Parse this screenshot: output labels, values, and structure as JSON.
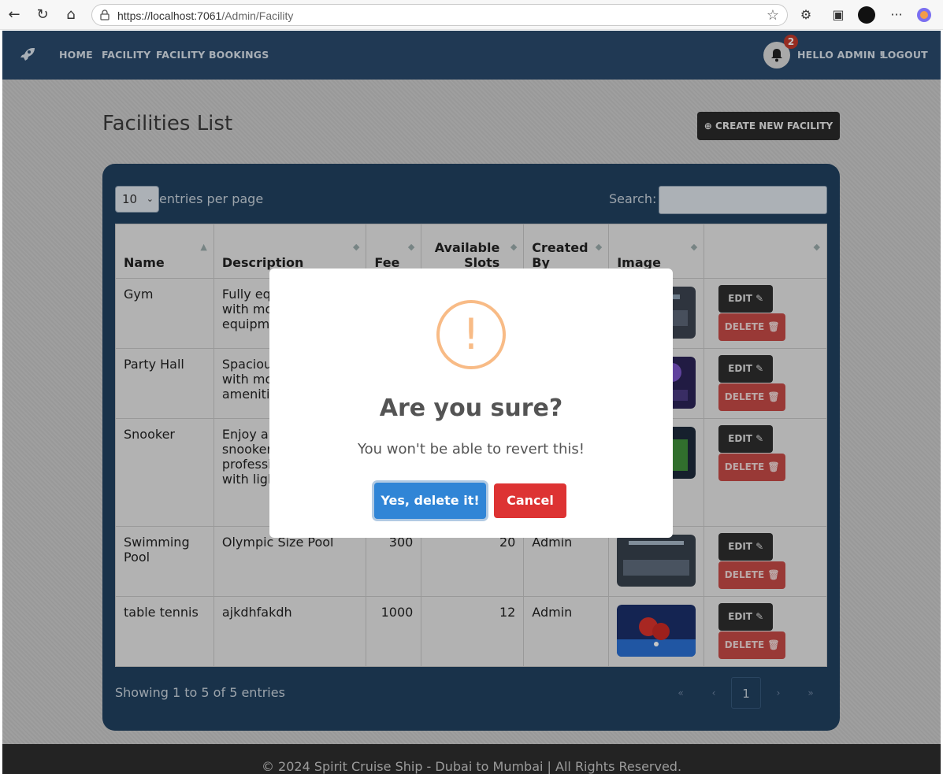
{
  "browser": {
    "url_host": "https://localhost:7061",
    "url_path": "/Admin/Facility"
  },
  "navbar": {
    "links": [
      "HOME",
      "FACILITY",
      "FACILITY BOOKINGS"
    ],
    "notifications_count": "2",
    "greeting": "HELLO ADMIN !",
    "logout": "LOGOUT",
    "bg_color": "#2a4a6c"
  },
  "page": {
    "title": "Facilities List",
    "create_button": "CREATE NEW FACILITY"
  },
  "table_controls": {
    "per_page_value": "10",
    "per_page_label": "entries per page",
    "search_label": "Search:"
  },
  "table": {
    "headers": [
      "Name",
      "Description",
      "Fee",
      "Available Slots",
      "Created By",
      "Image",
      ""
    ],
    "rows": [
      {
        "name": "Gym",
        "description": "Fully equipped gym with modern equipment",
        "fee": "",
        "slots": "",
        "created_by": "",
        "image": "gym"
      },
      {
        "name": "Party Hall",
        "description": "Spacious party hall with modern amenities",
        "fee": "",
        "slots": "",
        "created_by": "",
        "image": "party-hall"
      },
      {
        "name": "Snooker",
        "description": "Enjoy a game of snooker on professional tables with lighting",
        "fee": "",
        "slots": "",
        "created_by": "",
        "image": "snooker"
      },
      {
        "name": "Swimming Pool",
        "description": "Olympic Size Pool",
        "fee": "300",
        "slots": "20",
        "created_by": "Admin",
        "image": "pool"
      },
      {
        "name": "table tennis",
        "description": "ajkdhfakdh",
        "fee": "1000",
        "slots": "12",
        "created_by": "Admin",
        "image": "table-tennis"
      }
    ],
    "edit_label": "EDIT",
    "delete_label": "DELETE"
  },
  "pagination": {
    "summary": "Showing 1 to 5 of 5 entries",
    "first": "«",
    "prev": "‹",
    "current": "1",
    "next": "›",
    "last": "»"
  },
  "footer": {
    "text": "© 2024 Spirit Cruise Ship - Dubai to Mumbai | All Rights Reserved."
  },
  "modal": {
    "icon": "warning-icon",
    "title": "Are you sure?",
    "text": "You won't be able to revert this!",
    "confirm": "Yes, delete it!",
    "cancel": "Cancel",
    "warn_color": "#f8bb86",
    "confirm_color": "#3085d6",
    "cancel_color": "#dd3333"
  }
}
